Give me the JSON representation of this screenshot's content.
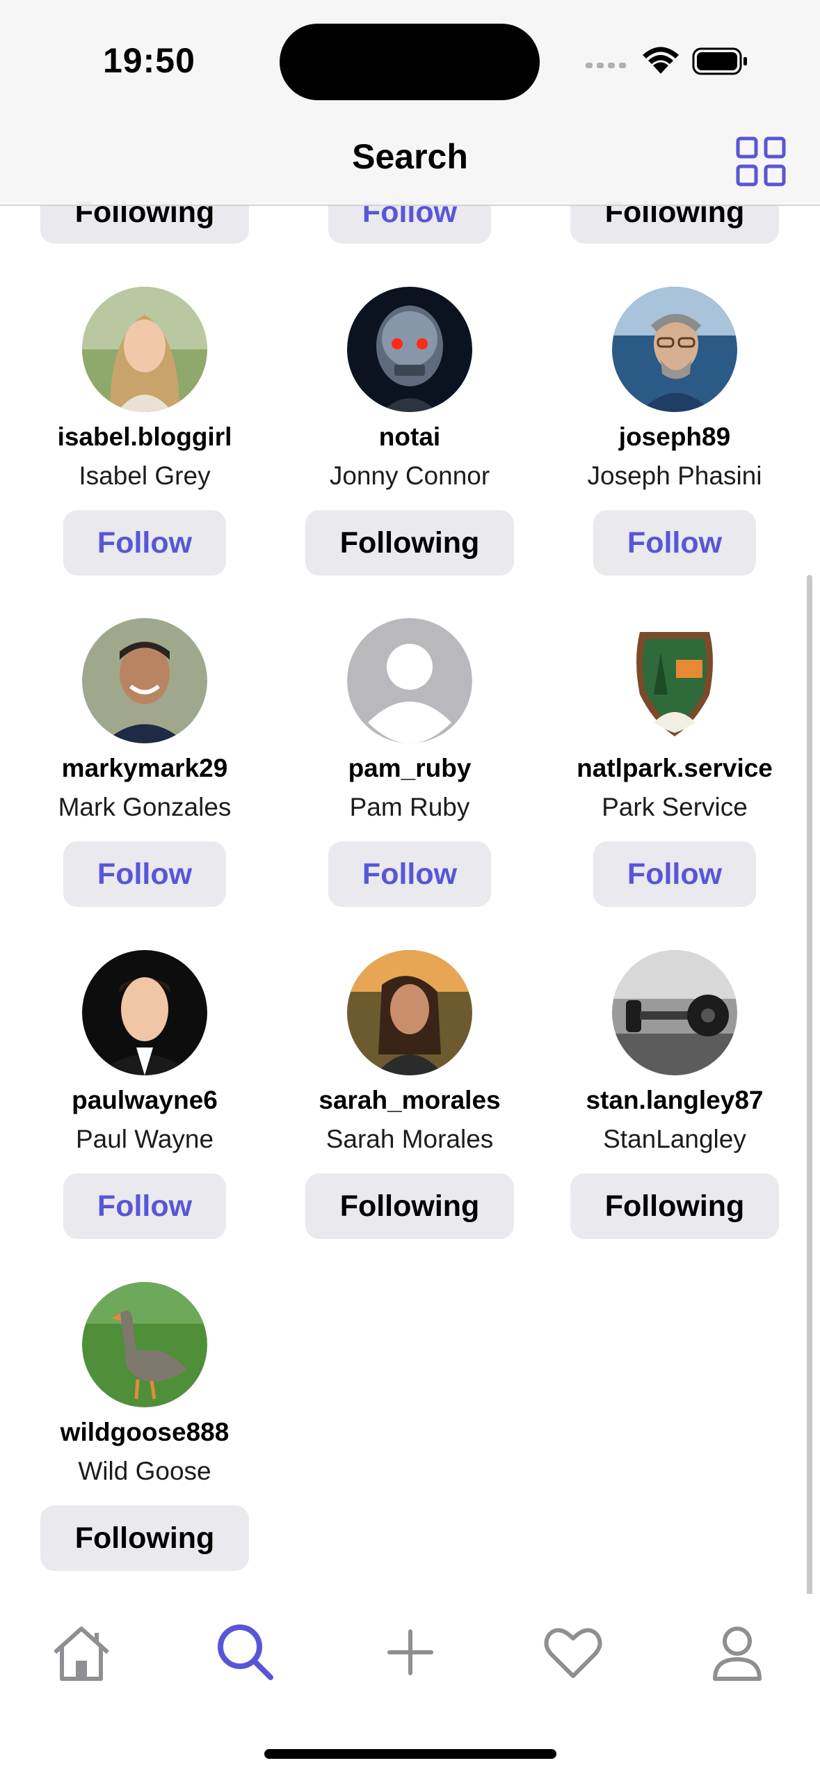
{
  "status_bar": {
    "time": "19:50"
  },
  "nav": {
    "title": "Search",
    "grid_icon": "grid-icon"
  },
  "top_partial_buttons": [
    {
      "label": "Following",
      "state": "following"
    },
    {
      "label": "Follow",
      "state": "follow"
    },
    {
      "label": "Following",
      "state": "following"
    }
  ],
  "users": [
    {
      "username": "isabel.bloggirl",
      "name": "Isabel Grey",
      "button": "Follow",
      "state": "follow",
      "avatar": "photo-woman-blonde"
    },
    {
      "username": "notai",
      "name": "Jonny Connor",
      "button": "Following",
      "state": "following",
      "avatar": "photo-robot-skull"
    },
    {
      "username": "joseph89",
      "name": "Joseph Phasini",
      "button": "Follow",
      "state": "follow",
      "avatar": "photo-man-glasses"
    },
    {
      "username": "markymark29",
      "name": "Mark Gonzales",
      "button": "Follow",
      "state": "follow",
      "avatar": "photo-man-smiling"
    },
    {
      "username": "pam_ruby",
      "name": "Pam Ruby",
      "button": "Follow",
      "state": "follow",
      "avatar": "default-person-icon"
    },
    {
      "username": "natlpark.service",
      "name": "Park Service",
      "button": "Follow",
      "state": "follow",
      "avatar": "park-service-badge"
    },
    {
      "username": "paulwayne6",
      "name": "Paul Wayne",
      "button": "Follow",
      "state": "follow",
      "avatar": "photo-man-suit"
    },
    {
      "username": "sarah_morales",
      "name": "Sarah Morales",
      "button": "Following",
      "state": "following",
      "avatar": "photo-woman-sunset"
    },
    {
      "username": "stan.langley87",
      "name": "StanLangley",
      "button": "Following",
      "state": "following",
      "avatar": "photo-dumbbells"
    },
    {
      "username": "wildgoose888",
      "name": "Wild Goose",
      "button": "Following",
      "state": "following",
      "avatar": "photo-goose"
    }
  ],
  "tabbar": {
    "items": [
      {
        "icon": "home-icon"
      },
      {
        "icon": "search-icon",
        "active": true
      },
      {
        "icon": "plus-icon"
      },
      {
        "icon": "heart-icon"
      },
      {
        "icon": "profile-icon"
      }
    ],
    "accent": "#5856d6",
    "inactive": "#8e8e93"
  }
}
